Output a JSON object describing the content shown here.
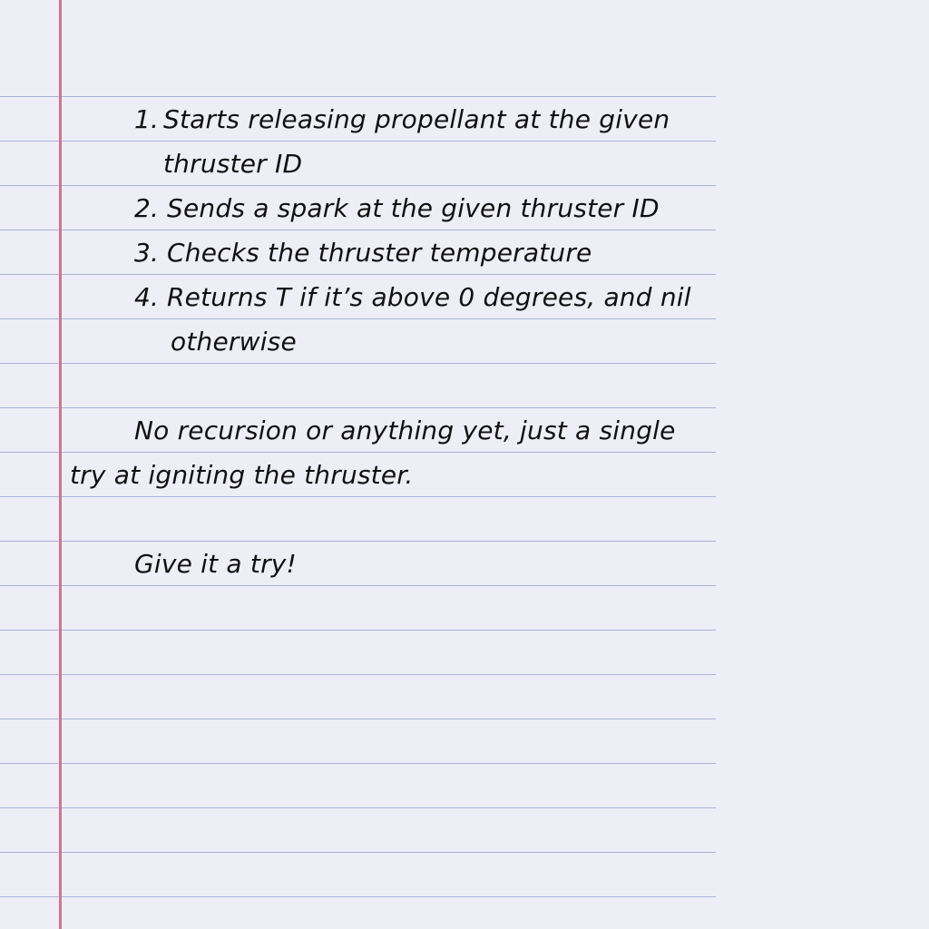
{
  "notebook": {
    "list_items": [
      {
        "number": "1.",
        "text": "Starts releasing propellant at the given",
        "continuation": "thruster ID"
      },
      {
        "number": "2.",
        "text": "Sends a spark at the given thruster ID"
      },
      {
        "number": "3.",
        "text": "Checks the thruster temperature"
      },
      {
        "number": "4.",
        "text": "Returns T if it’s above 0 degrees, and nil",
        "continuation": "otherwise"
      }
    ],
    "paragraph_1_line_1": "No recursion or anything yet, just a single",
    "paragraph_1_line_2": "try at igniting the thruster.",
    "paragraph_2": "Give it a try!"
  },
  "colors": {
    "paper": "#eeeef7",
    "rule_lines": "#a9b4d6",
    "margin_line": "#d1768f",
    "ink": "#111111"
  }
}
